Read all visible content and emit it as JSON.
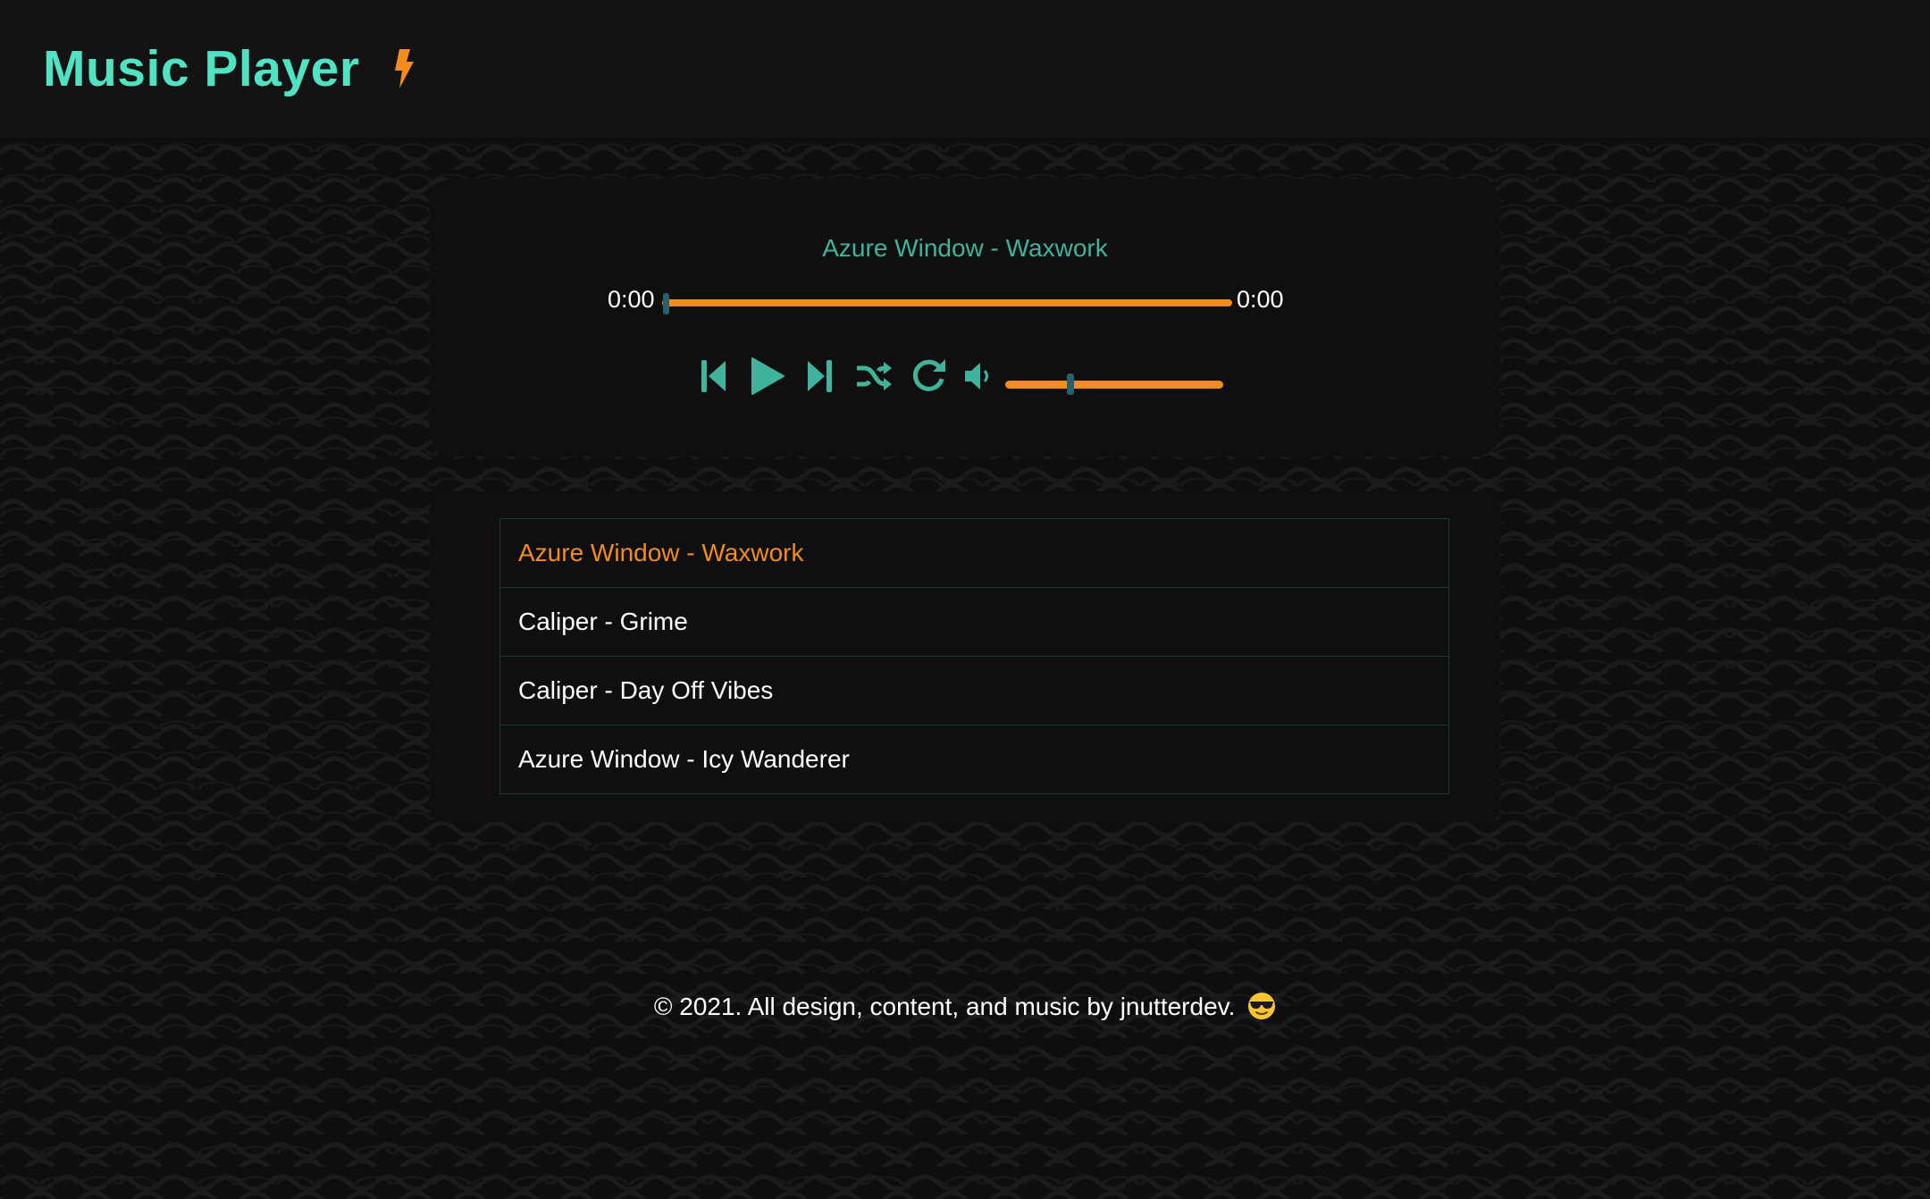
{
  "header": {
    "title": "Music Player",
    "icon": "lightning-bolt-icon"
  },
  "player": {
    "now_playing": "Azure Window - Waxwork",
    "current_time": "0:00",
    "total_time": "0:00",
    "progress": 0,
    "volume": 0.3,
    "controls": [
      {
        "name": "previous",
        "icon": "skip-back-icon"
      },
      {
        "name": "play",
        "icon": "play-icon"
      },
      {
        "name": "next",
        "icon": "skip-forward-icon"
      },
      {
        "name": "shuffle",
        "icon": "shuffle-icon"
      },
      {
        "name": "repeat",
        "icon": "repeat-icon"
      },
      {
        "name": "volume",
        "icon": "volume-icon"
      }
    ]
  },
  "playlist": {
    "tracks": [
      {
        "label": "Azure Window - Waxwork",
        "active": true
      },
      {
        "label": "Caliper - Grime",
        "active": false
      },
      {
        "label": "Caliper - Day Off Vibes",
        "active": false
      },
      {
        "label": "Azure Window - Icy Wanderer",
        "active": false
      }
    ]
  },
  "footer": {
    "text": "© 2021. All design, content, and music by jnutterdev.",
    "emoji_icon": "sunglasses-emoji-icon"
  },
  "colors": {
    "accent_teal": "#4fe3c4",
    "teal_muted": "#3fb39c",
    "accent_orange": "#f28c1c",
    "thumb": "#2b5f6e",
    "background": "#0e0e0e"
  }
}
